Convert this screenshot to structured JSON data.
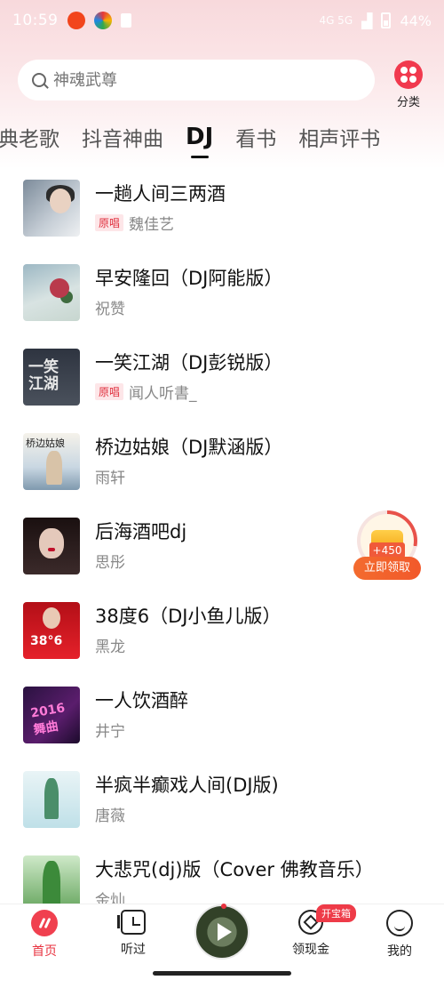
{
  "status_bar": {
    "time": "10:59",
    "network": "4G 5G",
    "battery": "44%"
  },
  "search": {
    "placeholder": "神魂武尊"
  },
  "category": {
    "label": "分类"
  },
  "tabs": [
    {
      "label": "典老歌"
    },
    {
      "label": "抖音神曲"
    },
    {
      "label": "DJ"
    },
    {
      "label": "看书"
    },
    {
      "label": "相声评书"
    }
  ],
  "songs": [
    {
      "title": "一趟人间三两酒",
      "badge": "原唱",
      "artist": "魏佳艺"
    },
    {
      "title": "早安隆回（DJ阿能版）",
      "badge": "",
      "artist": "祝赞"
    },
    {
      "title": "一笑江湖（DJ彭锐版）",
      "badge": "原唱",
      "artist": "闻人听書_"
    },
    {
      "title": "桥边姑娘（DJ默涵版）",
      "badge": "",
      "artist": "雨轩"
    },
    {
      "title": "后海酒吧dj",
      "badge": "",
      "artist": "思彤"
    },
    {
      "title": "38度6（DJ小鱼儿版）",
      "badge": "",
      "artist": "黑龙"
    },
    {
      "title": "一人饮酒醉",
      "badge": "",
      "artist": "井宁"
    },
    {
      "title": "半疯半癫戏人间(DJ版)",
      "badge": "",
      "artist": "唐薇"
    },
    {
      "title": "大悲咒(dj)版（Cover 佛教音乐）",
      "badge": "",
      "artist": "金灿"
    }
  ],
  "cover_text": {
    "c3": "一笑\n江湖",
    "c4": "桥边姑娘",
    "c6": "38°6",
    "c7": "2016 舞曲"
  },
  "reward": {
    "amount": "+450",
    "button": "立即领取"
  },
  "bottom_nav": {
    "home": "首页",
    "history": "听过",
    "earn": "领现金",
    "treasure_badge": "开宝箱",
    "me": "我的"
  },
  "colors": {
    "accent": "#e8323f",
    "orange": "#f36b2e"
  }
}
